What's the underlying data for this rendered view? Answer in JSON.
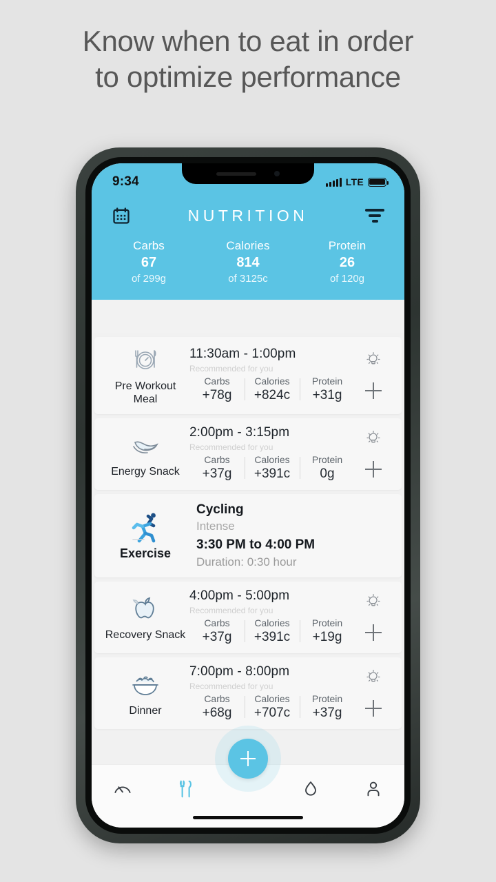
{
  "headline": "Know when to eat in order to optimize performance",
  "statusbar": {
    "time": "9:34",
    "network": "LTE",
    "signal_icon": "signal-bars-icon",
    "battery_icon": "battery-full-icon"
  },
  "header": {
    "title": "NUTRITION",
    "calendar_icon": "calendar-icon",
    "filter_icon": "filter-icon"
  },
  "macros": [
    {
      "label": "Carbs",
      "value": "67",
      "of": "of 299g"
    },
    {
      "label": "Calories",
      "value": "814",
      "of": "of 3125c"
    },
    {
      "label": "Protein",
      "value": "26",
      "of": "of 120g"
    }
  ],
  "colors": {
    "accent": "#5bc4e4",
    "page_background": "#e4e4e4",
    "card_background": "#f7f7f7"
  },
  "recommended_label": "Recommended for you",
  "cards": [
    {
      "kind": "meal",
      "type": "Pre Workout Meal",
      "icon": "plate-clock-icon",
      "time": "11:30am - 1:00pm",
      "recommended": "Recommended for you",
      "nutrition": [
        {
          "label": "Carbs",
          "value": "+78g"
        },
        {
          "label": "Calories",
          "value": "+824c"
        },
        {
          "label": "Protein",
          "value": "+31g"
        }
      ],
      "tip_icon": "lightbulb-icon",
      "add_icon": "plus-icon"
    },
    {
      "kind": "meal",
      "type": "Energy Snack",
      "icon": "banana-icon",
      "time": "2:00pm - 3:15pm",
      "recommended": "Recommended for you",
      "nutrition": [
        {
          "label": "Carbs",
          "value": "+37g"
        },
        {
          "label": "Calories",
          "value": "+391c"
        },
        {
          "label": "Protein",
          "value": "0g"
        }
      ],
      "tip_icon": "lightbulb-icon",
      "add_icon": "plus-icon"
    },
    {
      "kind": "exercise",
      "type": "Exercise",
      "icon": "runner-icon",
      "name": "Cycling",
      "intensity": "Intense",
      "range": "3:30 PM to 4:00 PM",
      "duration": "Duration: 0:30 hour"
    },
    {
      "kind": "meal",
      "type": "Recovery Snack",
      "icon": "apple-icon",
      "time": "4:00pm - 5:00pm",
      "recommended": "Recommended for you",
      "nutrition": [
        {
          "label": "Carbs",
          "value": "+37g"
        },
        {
          "label": "Calories",
          "value": "+391c"
        },
        {
          "label": "Protein",
          "value": "+19g"
        }
      ],
      "tip_icon": "lightbulb-icon",
      "add_icon": "plus-icon"
    },
    {
      "kind": "meal",
      "type": "Dinner",
      "icon": "bowl-icon",
      "time": "7:00pm - 8:00pm",
      "recommended": "Recommended for you",
      "nutrition": [
        {
          "label": "Carbs",
          "value": "+68g"
        },
        {
          "label": "Calories",
          "value": "+707c"
        },
        {
          "label": "Protein",
          "value": "+37g"
        }
      ],
      "tip_icon": "lightbulb-icon",
      "add_icon": "plus-icon"
    }
  ],
  "tabbar": {
    "items": [
      {
        "icon": "dashboard-gauge-icon",
        "active": false
      },
      {
        "icon": "fork-knife-icon",
        "active": true
      },
      {
        "icon": "water-drop-icon",
        "active": false
      },
      {
        "icon": "person-icon",
        "active": false
      }
    ],
    "fab_icon": "plus-icon"
  }
}
